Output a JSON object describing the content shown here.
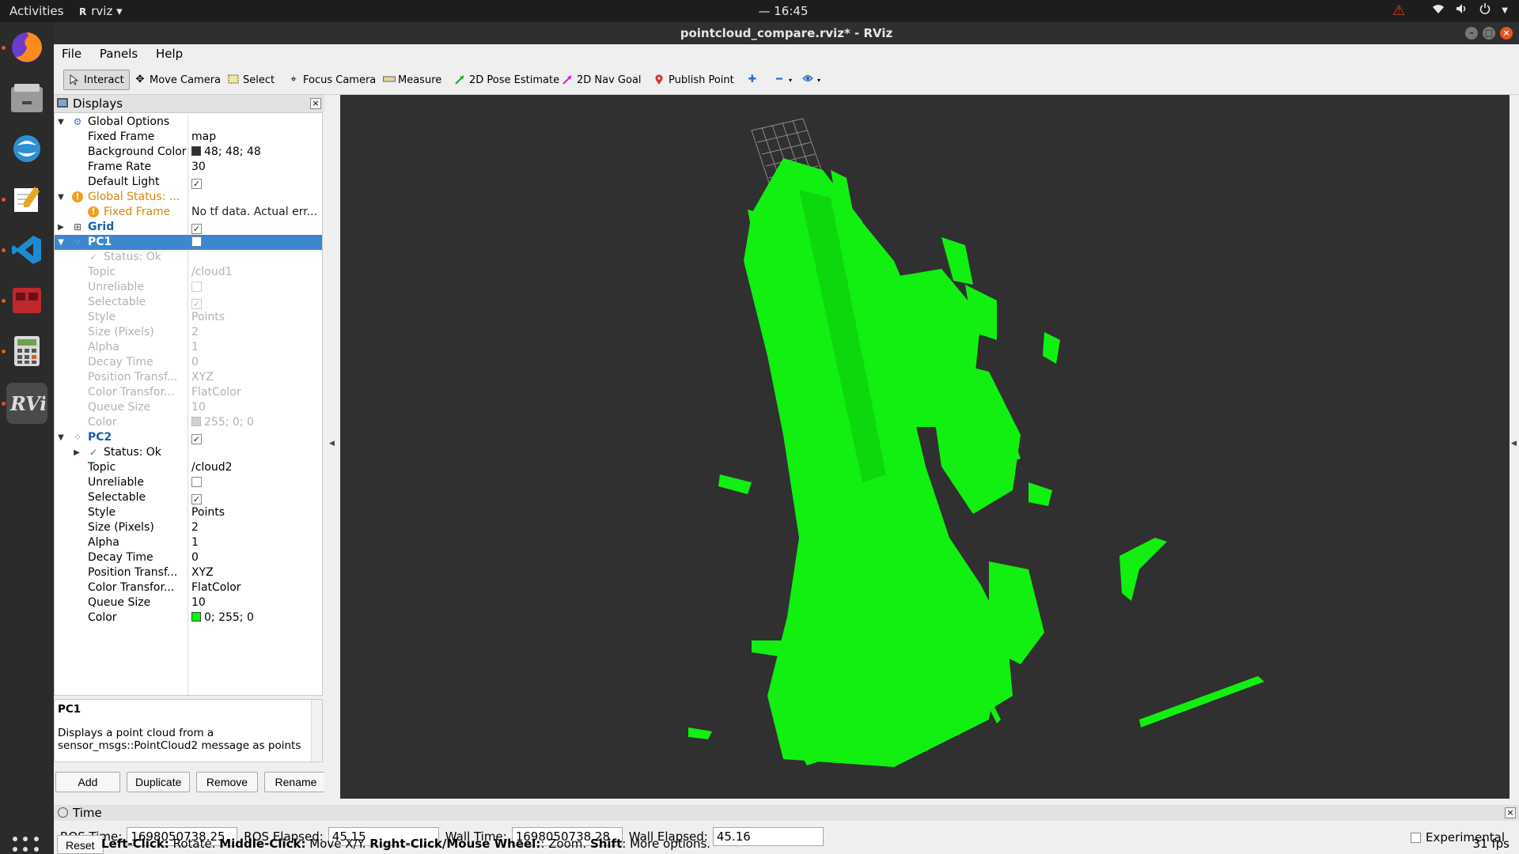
{
  "topbar": {
    "activities": "Activities",
    "app_name": "rviz",
    "clock": "— 16:45"
  },
  "dock": {
    "items": [
      "firefox-icon",
      "files-icon",
      "app-icon",
      "text-editor-icon",
      "vscode-icon",
      "terminal-icon",
      "calculator-icon",
      "rviz-icon"
    ]
  },
  "window": {
    "title": "pointcloud_compare.rviz* - RViz"
  },
  "menubar": {
    "file": "File",
    "panels": "Panels",
    "help": "Help"
  },
  "toolbar": {
    "interact": "Interact",
    "move_camera": "Move Camera",
    "select": "Select",
    "focus_camera": "Focus Camera",
    "measure": "Measure",
    "pose_estimate": "2D Pose Estimate",
    "nav_goal": "2D Nav Goal",
    "publish_point": "Publish Point"
  },
  "displays": {
    "header": "Displays",
    "global_options": {
      "label": "Global Options",
      "fixed_frame_label": "Fixed Frame",
      "fixed_frame_value": "map",
      "bg_color_label": "Background Color",
      "bg_color_value": "48; 48; 48",
      "bg_color_hex": "#303030",
      "frame_rate_label": "Frame Rate",
      "frame_rate_value": "30",
      "default_light_label": "Default Light",
      "default_light_checked": true
    },
    "global_status": {
      "label": "Global Status: ...",
      "fixed_frame_label": "Fixed Frame",
      "fixed_frame_value": "No tf data.  Actual err..."
    },
    "grid": {
      "label": "Grid",
      "checked": true
    },
    "pc1": {
      "label": "PC1",
      "checked": false,
      "status": "Status: Ok",
      "topic_label": "Topic",
      "topic_value": "/cloud1",
      "unreliable_label": "Unreliable",
      "selectable_label": "Selectable",
      "style_label": "Style",
      "style_value": "Points",
      "size_label": "Size (Pixels)",
      "size_value": "2",
      "alpha_label": "Alpha",
      "alpha_value": "1",
      "decay_label": "Decay Time",
      "decay_value": "0",
      "pos_label": "Position Transf...",
      "pos_value": "XYZ",
      "color_tf_label": "Color Transfor...",
      "color_tf_value": "FlatColor",
      "queue_label": "Queue Size",
      "queue_value": "10",
      "color_label": "Color",
      "color_value": "255; 0; 0"
    },
    "pc2": {
      "label": "PC2",
      "checked": true,
      "status": "Status: Ok",
      "topic_label": "Topic",
      "topic_value": "/cloud2",
      "unreliable_label": "Unreliable",
      "selectable_label": "Selectable",
      "style_label": "Style",
      "style_value": "Points",
      "size_label": "Size (Pixels)",
      "size_value": "2",
      "alpha_label": "Alpha",
      "alpha_value": "1",
      "decay_label": "Decay Time",
      "decay_value": "0",
      "pos_label": "Position Transf...",
      "pos_value": "XYZ",
      "color_tf_label": "Color Transfor...",
      "color_tf_value": "FlatColor",
      "queue_label": "Queue Size",
      "queue_value": "10",
      "color_label": "Color",
      "color_value": "0; 255; 0",
      "color_hex": "#00ff00"
    },
    "description": {
      "title": "PC1",
      "text": "Displays a point cloud from a sensor_msgs::PointCloud2 message as points"
    },
    "buttons": {
      "add": "Add",
      "duplicate": "Duplicate",
      "remove": "Remove",
      "rename": "Rename"
    }
  },
  "time": {
    "header": "Time",
    "ros_time_label": "ROS Time:",
    "ros_time_value": "1698050738.25",
    "ros_elapsed_label": "ROS Elapsed:",
    "ros_elapsed_value": "45.15",
    "wall_time_label": "Wall Time:",
    "wall_time_value": "1698050738.28",
    "wall_elapsed_label": "Wall Elapsed:",
    "wall_elapsed_value": "45.16",
    "experimental": "Experimental"
  },
  "status": {
    "reset": "Reset",
    "left_click_b": "Left-Click:",
    "left_click": " Rotate. ",
    "middle_click_b": "Middle-Click:",
    "middle_click": " Move X/Y. ",
    "right_click_b": "Right-Click/Mouse Wheel:",
    "right_click": ": Zoom. ",
    "shift_b": "Shift",
    "shift": ": More options.",
    "fps": "31 fps"
  }
}
